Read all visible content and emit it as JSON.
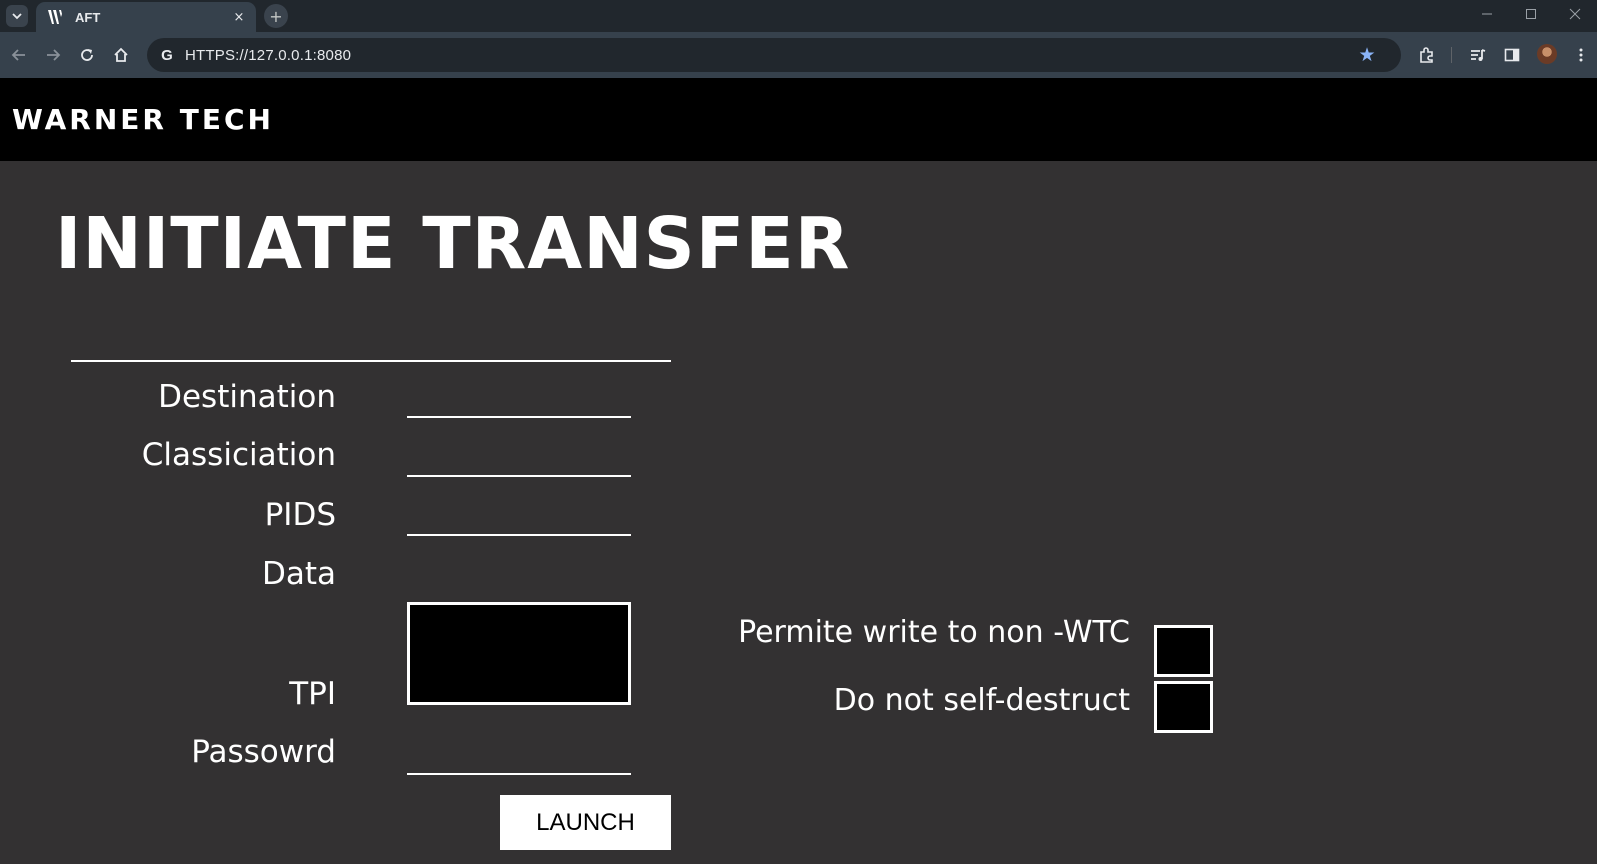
{
  "browser": {
    "tab_title": "AFT",
    "tab_close": "×",
    "new_tab": "+",
    "url": "HTTPS://127.0.0.1:8080",
    "omnibox_icon": "G",
    "icons": [
      "chevron-down-icon",
      "favicon-w-icon",
      "close-icon",
      "plus-icon",
      "back-icon",
      "forward-icon",
      "reload-icon",
      "home-icon",
      "star-icon",
      "extensions-icon",
      "media-icon",
      "side-panel-icon",
      "avatar",
      "menu-icon",
      "minimize-icon",
      "maximize-icon",
      "window-close-icon"
    ],
    "accent_color": "#8ab4f8"
  },
  "header": {
    "brand": "WARNER TECH"
  },
  "main": {
    "title": "INITIATE TRANSFER",
    "fields": {
      "destination": {
        "label": "Destination",
        "value": ""
      },
      "classiciation": {
        "label": "Classiciation",
        "value": ""
      },
      "pids": {
        "label": "PIDS",
        "value": ""
      },
      "data": {
        "label": "Data",
        "value": ""
      },
      "tpi": {
        "label": "TPI"
      },
      "password": {
        "label": "Passowrd",
        "value": ""
      }
    },
    "checkboxes": {
      "permit_write": {
        "label": "Permite write to non -WTC",
        "checked": false
      },
      "no_self_destruct": {
        "label": "Do not self-destruct",
        "checked": false
      }
    },
    "launch_label": "LAUNCH"
  }
}
